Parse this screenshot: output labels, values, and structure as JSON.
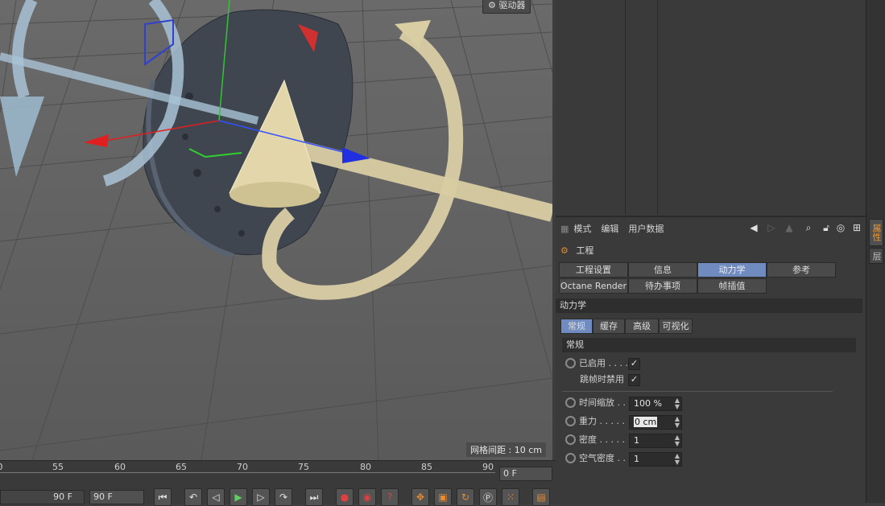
{
  "viewport": {
    "driver_tag": "驱动器",
    "grid_spacing": "网格间距 : 10 cm"
  },
  "timeline": {
    "ticks": [
      "0",
      "55",
      "60",
      "65",
      "70",
      "75",
      "80",
      "85",
      "90"
    ],
    "current_frame": "0 F",
    "range_left": "90 F",
    "range_right": "90 F"
  },
  "attributes": {
    "menu": [
      "模式",
      "编辑",
      "用户数据"
    ],
    "object_title": "工程",
    "tabs_row1": [
      "工程设置",
      "信息",
      "动力学",
      "参考"
    ],
    "tabs_row2": [
      "Octane Render",
      "待办事项",
      "帧插值"
    ],
    "active_tab": "动力学",
    "section_title": "动力学",
    "subtabs": [
      "常规",
      "缓存",
      "高级",
      "可视化"
    ],
    "active_subtab": "常规",
    "group_title": "常规",
    "enabled_label": "已启用 . . . .",
    "enabled_value": "✓",
    "skip_disable_label": "跳帧时禁用",
    "skip_disable_value": "✓",
    "time_scale_label": "时间缩放 . .",
    "time_scale_value": "100 %",
    "gravity_label": "重力 . . . . .",
    "gravity_value": "0 cm",
    "density_label": "密度 . . . . .",
    "density_value": "1",
    "air_density_label": "空气密度 . .",
    "air_density_value": "1"
  },
  "side_tabs": [
    "属性",
    "层"
  ],
  "colors": {
    "accent_tab": "#6f8bbf",
    "side_active": "#f09a2e"
  }
}
